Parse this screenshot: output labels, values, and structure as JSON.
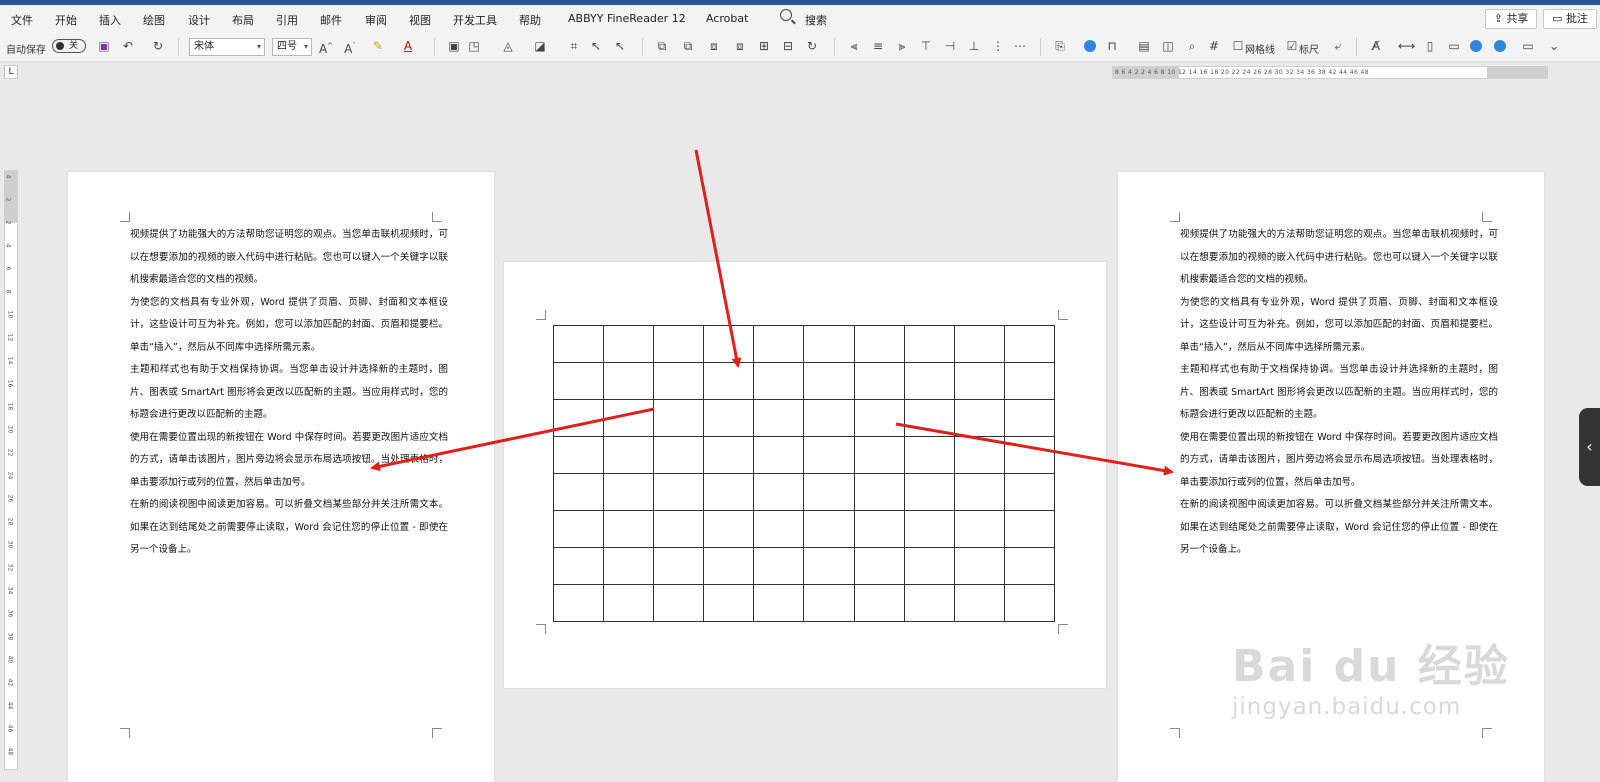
{
  "menu": {
    "items": [
      "文件",
      "开始",
      "插入",
      "绘图",
      "设计",
      "布局",
      "引用",
      "邮件",
      "审阅",
      "视图",
      "开发工具",
      "帮助",
      "ABBYY FineReader 12",
      "Acrobat"
    ],
    "search_label": "搜索",
    "share_label": "共享",
    "comment_label": "批注"
  },
  "toolbar": {
    "autosave_label": "自动保存",
    "autosave_state": "关",
    "font_name": "宋体",
    "font_size": "四号",
    "gridlines_label": "网格线",
    "ruler_label": "标尺"
  },
  "ruler": {
    "horizontal_numbers": "8  6  4  2     2  4  6  8  10 12 14 16 18 20 22 24 26 28 30 32 34 36 38    42 44 46 48",
    "vertical_numbers": [
      "4",
      "2",
      "2",
      "4",
      "6",
      "8",
      "10",
      "12",
      "14",
      "16",
      "18",
      "20",
      "22",
      "24",
      "26",
      "28",
      "30",
      "32",
      "34",
      "36",
      "38",
      "40",
      "42",
      "44",
      "46",
      "48"
    ]
  },
  "document": {
    "paragraphs": [
      "视频提供了功能强大的方法帮助您证明您的观点。当您单击联机视频时，可以在想要添加的视频的嵌入代码中进行粘贴。您也可以键入一个关键字以联机搜索最适合您的文档的视频。",
      "为使您的文档具有专业外观，Word 提供了页眉、页脚、封面和文本框设计，这些设计可互为补充。例如，您可以添加匹配的封面、页眉和提要栏。单击“插入”，然后从不同库中选择所需元素。",
      "主题和样式也有助于文档保持协调。当您单击设计并选择新的主题时，图片、图表或 SmartArt 图形将会更改以匹配新的主题。当应用样式时，您的标题会进行更改以匹配新的主题。",
      "使用在需要位置出现的新按钮在 Word 中保存时间。若要更改图片适应文档的方式，请单击该图片，图片旁边将会显示布局选项按钮。当处理表格时，单击要添加行或列的位置，然后单击加号。",
      "在新的阅读视图中阅读更加容易。可以折叠文档某些部分并关注所需文本。如果在达到结尾处之前需要停止读取，Word 会记住您的停止位置 - 即使在另一个设备上。"
    ],
    "table_rows": 8,
    "table_cols": 10
  },
  "watermark": {
    "logo": "Bai du 经验",
    "site": "jingyan.baidu.com"
  },
  "colors": {
    "arrow": "#e0201b",
    "accent": "#2b579a"
  }
}
